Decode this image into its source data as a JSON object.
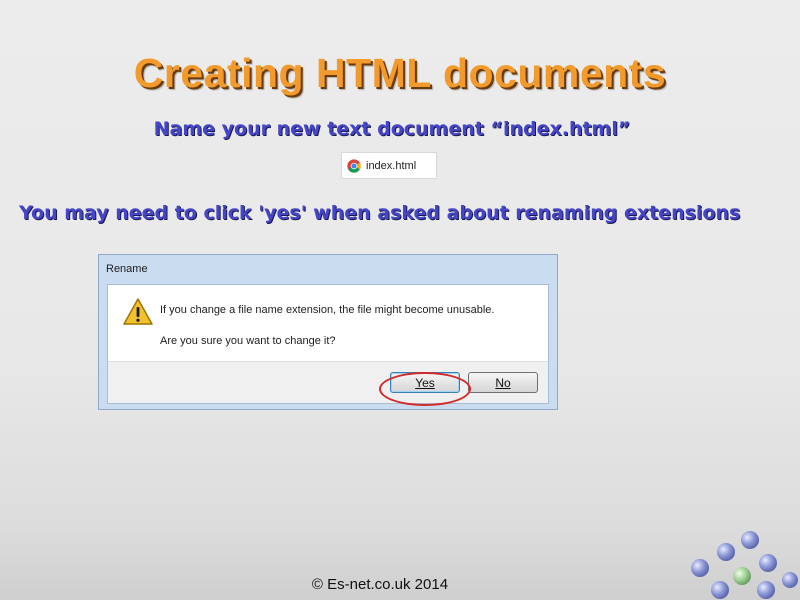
{
  "slide": {
    "title": "Creating HTML documents",
    "subtitle": "Name your new text document “index.html”",
    "file_name": "index.html",
    "note": "You may need to click 'yes' when asked about renaming extensions",
    "footer": "© Es-net.co.uk 2014"
  },
  "dialog": {
    "title": "Rename",
    "message_line1": "If you change a file name extension, the file might become unusable.",
    "message_line2": "Are you sure you want to change it?",
    "yes_label": "Yes",
    "no_label": "No",
    "icon": "warning-icon"
  },
  "icons": {
    "file": "chrome-icon",
    "decoration": "orbs-decoration"
  },
  "colors": {
    "title": "#f39a2c",
    "subtitle": "#4545c8",
    "highlight_ring": "#d22a2a"
  }
}
